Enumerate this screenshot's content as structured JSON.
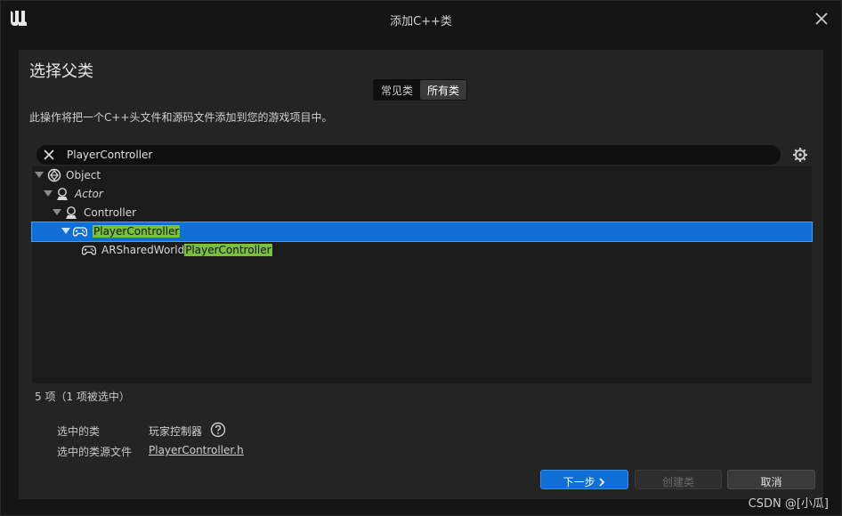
{
  "window": {
    "title": "添加C++类"
  },
  "header": {
    "heading": "选择父类",
    "tabs": [
      {
        "label": "常见类",
        "active": false
      },
      {
        "label": "所有类",
        "active": true
      }
    ],
    "description": "此操作将把一个C++头文件和源码文件添加到您的游戏项目中。"
  },
  "search": {
    "value": "PlayerController",
    "placeholder": ""
  },
  "tree": {
    "rows": [
      {
        "pre": "Object",
        "match": "",
        "post": "",
        "icon": "object-icon",
        "expanded": true
      },
      {
        "pre": "Actor",
        "match": "",
        "post": "",
        "icon": "actor-icon",
        "expanded": true
      },
      {
        "pre": "Controller",
        "match": "",
        "post": "",
        "icon": "controller-icon",
        "expanded": true
      },
      {
        "pre": "",
        "match": "PlayerController",
        "post": "",
        "icon": "gamepad-icon",
        "expanded": true,
        "selected": true
      },
      {
        "pre": "ARSharedWorld",
        "match": "PlayerController",
        "post": "",
        "icon": "gamepad-icon"
      }
    ]
  },
  "status": {
    "count": "5 项（1 项被选中）"
  },
  "info": {
    "selected_class_label": "选中的类",
    "selected_class_value": "玩家控制器",
    "source_file_label": "选中的类源文件",
    "source_file_value": "PlayerController.h"
  },
  "buttons": {
    "next": "下一步",
    "create": "创建类",
    "cancel": "取消"
  },
  "watermark": "CSDN @[小瓜]",
  "colors": {
    "accent": "#0f6fd6",
    "highlight": "#7ac13a",
    "background": "#151515",
    "panel": "#242424"
  }
}
